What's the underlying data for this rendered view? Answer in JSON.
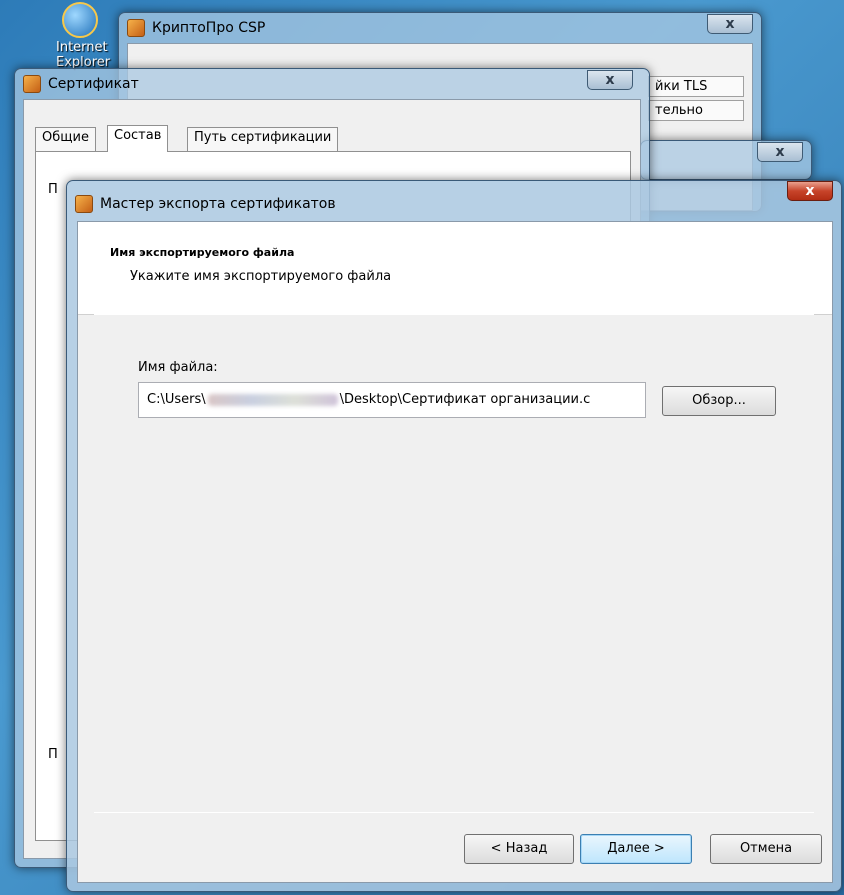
{
  "desktop": {
    "icon_label": "Internet Explorer"
  },
  "csp_window": {
    "title": "КриптоПро CSP",
    "close": "x",
    "tabs_visible": [
      "йки TLS",
      "тельно"
    ]
  },
  "cert_window": {
    "title": "Сертификат",
    "close": "x",
    "tabs": [
      "Общие",
      "Состав",
      "Путь сертификации"
    ],
    "active_tab": "Состав",
    "partial_labels": [
      "П",
      "П"
    ]
  },
  "third_window": {
    "close": "x"
  },
  "wizard": {
    "title": "Мастер экспорта сертификатов",
    "close": "x",
    "header_title": "Имя экспортируемого файла",
    "header_subtitle": "Укажите имя экспортируемого файла",
    "file_label": "Имя файла:",
    "file_path_start": "C:\\Users\\",
    "file_path_end": "\\Desktop\\Сертификат организации.с",
    "browse_label": "Обзор...",
    "back_label": "< Назад",
    "next_label": "Далее >",
    "cancel_label": "Отмена"
  }
}
